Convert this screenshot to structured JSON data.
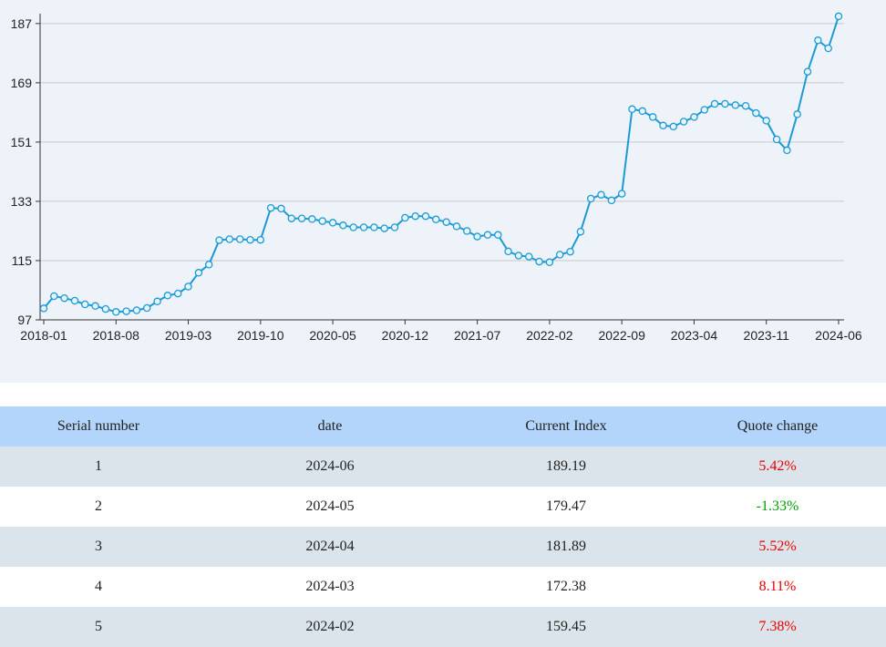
{
  "colors": {
    "line": "#1d9ad6",
    "marker_fill": "#e6f4fb",
    "grid": "#c8c8c8",
    "axis": "#333333",
    "positive": "#e60000",
    "negative": "#00a000"
  },
  "chart_data": {
    "type": "line",
    "x_ticks": [
      "2018-01",
      "2018-08",
      "2019-03",
      "2019-10",
      "2020-05",
      "2020-12",
      "2021-07",
      "2022-02",
      "2022-09",
      "2023-04",
      "2023-11",
      "2024-06"
    ],
    "y_ticks": [
      "187",
      "169",
      "151",
      "133",
      "115",
      "97"
    ],
    "ylim": [
      97,
      190
    ],
    "grid": "horizontal",
    "series": [
      {
        "x": [
          "2018-01",
          "2018-02",
          "2018-03",
          "2018-04",
          "2018-05",
          "2018-06",
          "2018-07",
          "2018-08",
          "2018-09",
          "2018-10",
          "2018-11",
          "2018-12",
          "2019-01",
          "2019-02",
          "2019-03",
          "2019-04",
          "2019-05",
          "2019-06",
          "2019-07",
          "2019-08",
          "2019-09",
          "2019-10",
          "2019-11",
          "2019-12",
          "2020-01",
          "2020-02",
          "2020-03",
          "2020-04",
          "2020-05",
          "2020-06",
          "2020-07",
          "2020-08",
          "2020-09",
          "2020-10",
          "2020-11",
          "2020-12",
          "2021-01",
          "2021-02",
          "2021-03",
          "2021-04",
          "2021-05",
          "2021-06",
          "2021-07",
          "2021-08",
          "2021-09",
          "2021-10",
          "2021-11",
          "2021-12",
          "2022-01",
          "2022-02",
          "2022-03",
          "2022-04",
          "2022-05",
          "2022-06",
          "2022-07",
          "2022-08",
          "2022-09",
          "2022-10",
          "2022-11",
          "2022-12",
          "2023-01",
          "2023-02",
          "2023-03",
          "2023-04",
          "2023-05",
          "2023-06",
          "2023-07",
          "2023-08",
          "2023-09",
          "2023-10",
          "2023-11",
          "2023-12",
          "2024-01",
          "2024-02",
          "2024-03",
          "2024-04",
          "2024-05",
          "2024-06"
        ],
        "values": [
          100.5,
          104.2,
          103.6,
          102.8,
          101.7,
          101.2,
          100.3,
          99.4,
          99.6,
          99.9,
          100.6,
          102.6,
          104.4,
          105.0,
          107.1,
          111.3,
          113.8,
          121.2,
          121.5,
          121.5,
          121.3,
          121.3,
          131.0,
          130.8,
          127.8,
          127.8,
          127.6,
          127.0,
          126.5,
          125.7,
          125.1,
          125.1,
          125.1,
          124.8,
          125.1,
          128.0,
          128.5,
          128.5,
          127.5,
          126.7,
          125.4,
          124.0,
          122.3,
          122.8,
          122.8,
          117.8,
          116.5,
          116.2,
          114.7,
          114.5,
          116.8,
          117.7,
          123.8,
          133.8,
          135.0,
          133.3,
          135.3,
          161.0,
          160.4,
          158.6,
          156.0,
          155.7,
          157.2,
          158.6,
          160.8,
          162.6,
          162.6,
          162.2,
          162.0,
          159.8,
          157.5,
          151.8,
          148.5,
          159.45,
          172.38,
          181.89,
          179.47,
          189.19
        ]
      }
    ]
  },
  "table": {
    "headers": [
      "Serial number",
      "date",
      "Current Index",
      "Quote change"
    ],
    "rows": [
      {
        "serial": "1",
        "date": "2024-06",
        "index": "189.19",
        "change": "5.42%",
        "direction": "up"
      },
      {
        "serial": "2",
        "date": "2024-05",
        "index": "179.47",
        "change": "-1.33%",
        "direction": "down"
      },
      {
        "serial": "3",
        "date": "2024-04",
        "index": "181.89",
        "change": "5.52%",
        "direction": "up"
      },
      {
        "serial": "4",
        "date": "2024-03",
        "index": "172.38",
        "change": "8.11%",
        "direction": "up"
      },
      {
        "serial": "5",
        "date": "2024-02",
        "index": "159.45",
        "change": "7.38%",
        "direction": "up"
      }
    ]
  }
}
